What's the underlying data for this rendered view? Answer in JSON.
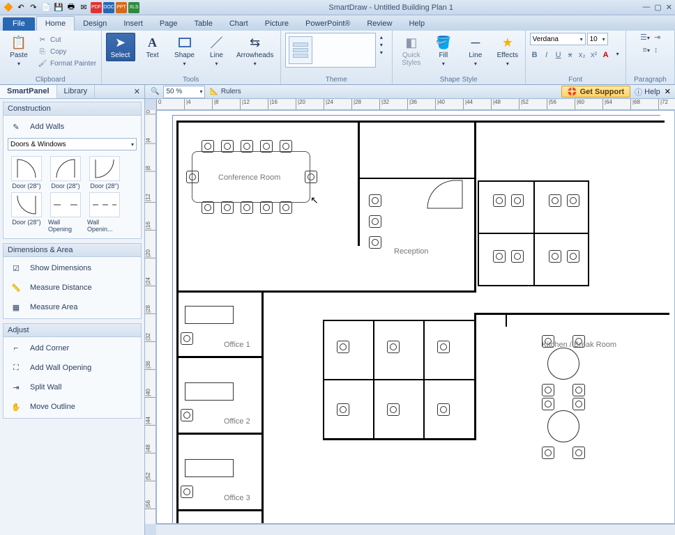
{
  "app_title": "SmartDraw - Untitled Building Plan 1",
  "menu_file": "File",
  "tabs": [
    "Home",
    "Design",
    "Insert",
    "Page",
    "Table",
    "Chart",
    "Picture",
    "PowerPoint®",
    "Review",
    "Help"
  ],
  "active_tab": "Home",
  "ribbon": {
    "clipboard": {
      "label": "Clipboard",
      "paste": "Paste",
      "cut": "Cut",
      "copy": "Copy",
      "format_painter": "Format Painter"
    },
    "tools": {
      "label": "Tools",
      "select": "Select",
      "text": "Text",
      "shape": "Shape",
      "line": "Line",
      "arrowheads": "Arrowheads"
    },
    "theme": {
      "label": "Theme"
    },
    "shape_style": {
      "label": "Shape Style",
      "quick_styles": "Quick\nStyles",
      "fill": "Fill",
      "line": "Line",
      "effects": "Effects"
    },
    "font": {
      "label": "Font",
      "family": "Verdana",
      "size": "10"
    },
    "paragraph": {
      "label": "Paragraph"
    }
  },
  "subbar": {
    "smartpanel": "SmartPanel",
    "library": "Library",
    "zoom_value": "50 %",
    "rulers": "Rulers",
    "get_support": "Get Support",
    "help": "Help"
  },
  "side": {
    "construction": {
      "title": "Construction",
      "add_walls": "Add Walls",
      "category": "Doors & Windows",
      "shapes": [
        "Door (28\")",
        "Door (28\")",
        "Door (28\")",
        "Door (28\")",
        "Wall Opening",
        "Wall Openin..."
      ]
    },
    "dimensions": {
      "title": "Dimensions & Area",
      "show_dimensions": "Show Dimensions",
      "measure_distance": "Measure Distance",
      "measure_area": "Measure Area"
    },
    "adjust": {
      "title": "Adjust",
      "add_corner": "Add Corner",
      "add_wall_opening": "Add Wall Opening",
      "split_wall": "Split Wall",
      "move_outline": "Move Outline"
    }
  },
  "ruler_ticks_h": [
    "0",
    "|4",
    "|8",
    "|12",
    "|16",
    "|20",
    "|24",
    "|28",
    "|32",
    "|36",
    "|40",
    "|44",
    "|48",
    "|52",
    "|56",
    "|60",
    "|64",
    "|68",
    "|72"
  ],
  "ruler_ticks_v": [
    "0",
    "|4",
    "|8",
    "|12",
    "|16",
    "|20",
    "|24",
    "|28",
    "|32",
    "|36",
    "|40",
    "|44",
    "|48",
    "|52",
    "|56"
  ],
  "rooms": {
    "conference": "Conference Room",
    "reception": "Reception",
    "office1": "Office 1",
    "office2": "Office 2",
    "office3": "Office 3",
    "kitchen": "Kitchen / Break Room"
  }
}
